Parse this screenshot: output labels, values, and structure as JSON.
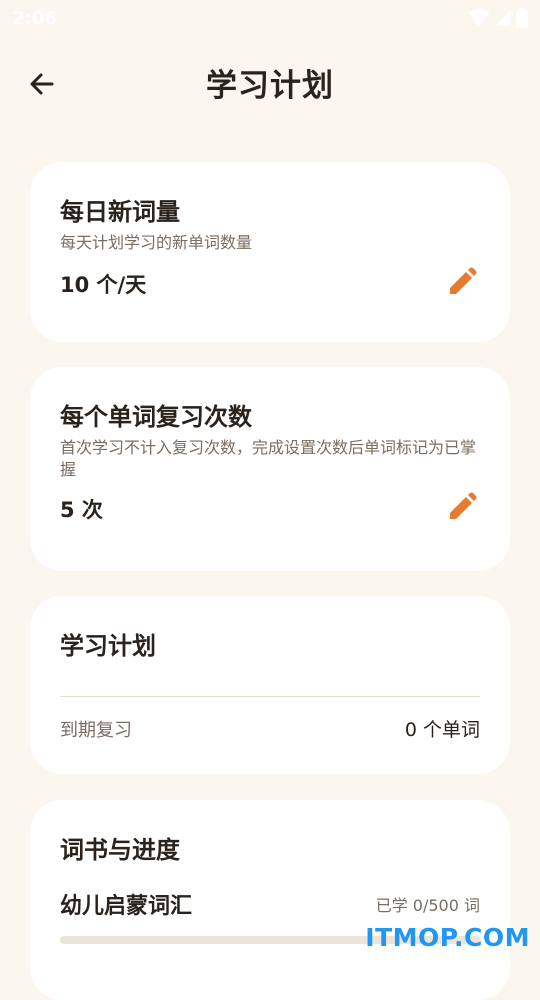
{
  "status_bar": {
    "time": "2:06"
  },
  "header": {
    "title": "学习计划"
  },
  "daily_new": {
    "title": "每日新词量",
    "description": "每天计划学习的新单词数量",
    "value": "10 个/天"
  },
  "review_count": {
    "title": "每个单词复习次数",
    "description": "首次学习不计入复习次数，完成设置次数后单词标记为已掌握",
    "value": "5 次"
  },
  "study_plan": {
    "title": "学习计划",
    "due_label": "到期复习",
    "due_value": "0 个单词"
  },
  "books": {
    "title": "词书与进度",
    "items": [
      {
        "name": "幼儿启蒙词汇",
        "progress_text": "已学 0/500 词",
        "learned": 0,
        "total": 500
      }
    ]
  },
  "watermark": "ITMOP.COM",
  "colors": {
    "accent": "#e67a2e",
    "background": "#fbf6ee",
    "card": "#ffffff"
  }
}
